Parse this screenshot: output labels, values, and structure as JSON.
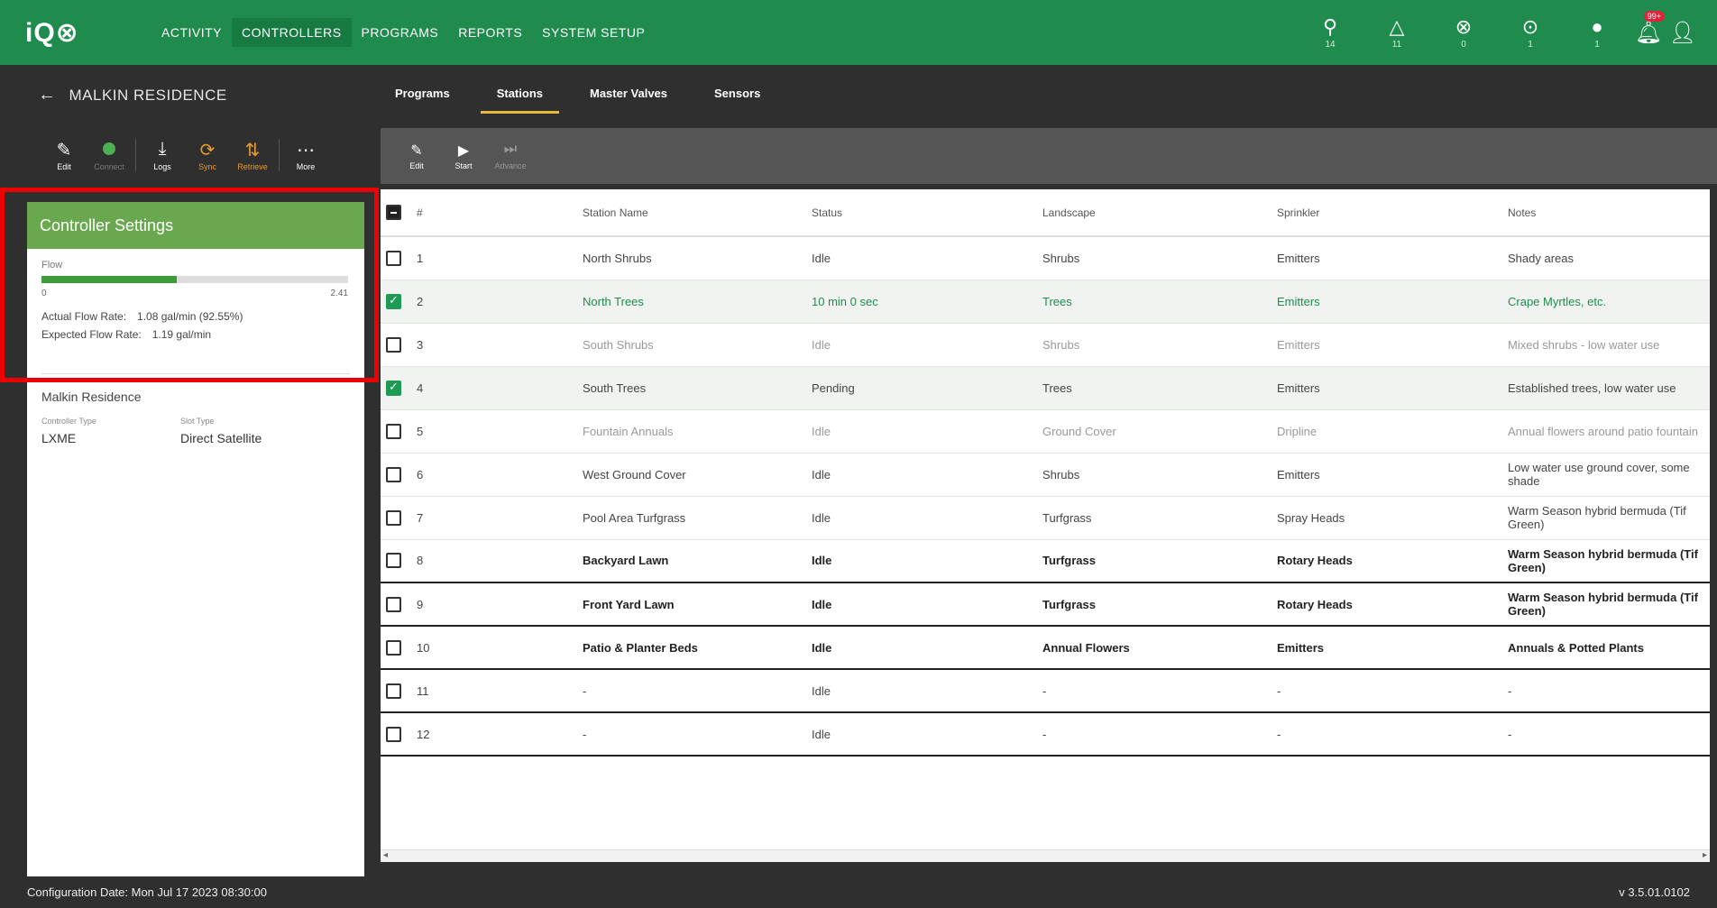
{
  "brand": {
    "logo": "iQ⊗"
  },
  "nav": {
    "items": [
      "ACTIVITY",
      "CONTROLLERS",
      "PROGRAMS",
      "REPORTS",
      "SYSTEM SETUP"
    ]
  },
  "status_icons": [
    {
      "icon": "flow-icon",
      "glyph": "⚲",
      "count": "14"
    },
    {
      "icon": "alert-triangle-icon",
      "glyph": "△",
      "count": "11"
    },
    {
      "icon": "stop-circle-icon",
      "glyph": "⊗",
      "count": "0"
    },
    {
      "icon": "play-circle-icon",
      "glyph": "⊙",
      "count": "1"
    },
    {
      "icon": "globe-icon",
      "glyph": "●",
      "count": "1"
    }
  ],
  "notifications": {
    "badge": "99+"
  },
  "left": {
    "back_label": "MALKIN RESIDENCE",
    "toolbar": [
      {
        "glyph": "✎",
        "label": "Edit",
        "style": ""
      },
      {
        "glyph": "",
        "label": "Connect",
        "style": "dim dotted"
      },
      {
        "glyph": "⤓",
        "label": "Logs",
        "style": ""
      },
      {
        "glyph": "⟳",
        "label": "Sync",
        "style": "orange"
      },
      {
        "glyph": "⇅",
        "label": "Retrieve",
        "style": "orange"
      },
      {
        "glyph": "⋯",
        "label": "More",
        "style": ""
      }
    ],
    "settings": {
      "title": "Controller Settings",
      "flow_label": "Flow",
      "flow_min": "0",
      "flow_max": "2.41",
      "flow_fraction": 0.44,
      "actual_label": "Actual Flow Rate:",
      "actual_value": "1.08 gal/min (92.55%)",
      "expected_label": "Expected Flow Rate:",
      "expected_value": "1.19 gal/min"
    },
    "residence": "Malkin Residence",
    "controller_type_label": "Controller Type",
    "controller_type": "LXME",
    "slot_type_label": "Slot Type",
    "slot_type": "Direct Satellite"
  },
  "tabs": [
    "Programs",
    "Stations",
    "Master Valves",
    "Sensors"
  ],
  "main_toolbar": [
    {
      "glyph": "✎",
      "label": "Edit",
      "dim": false
    },
    {
      "glyph": "▶",
      "label": "Start",
      "dim": false
    },
    {
      "glyph": "⏭",
      "label": "Advance",
      "dim": true
    }
  ],
  "table": {
    "headers": [
      "#",
      "Station Name",
      "Status",
      "Landscape",
      "Sprinkler",
      "Notes"
    ],
    "rows": [
      {
        "num": "1",
        "name": "North Shrubs",
        "status": "Idle",
        "landscape": "Shrubs",
        "sprinkler": "Emitters",
        "notes": "Shady areas",
        "checked": false,
        "sel": false,
        "cls": ""
      },
      {
        "num": "2",
        "name": "North Trees",
        "status": "10 min 0 sec",
        "landscape": "Trees",
        "sprinkler": "Emitters",
        "notes": "Crape Myrtles, etc.",
        "checked": true,
        "sel": true,
        "cls": "green"
      },
      {
        "num": "3",
        "name": "South Shrubs",
        "status": "Idle",
        "landscape": "Shrubs",
        "sprinkler": "Emitters",
        "notes": "Mixed shrubs - low water use",
        "checked": false,
        "sel": false,
        "cls": "muted"
      },
      {
        "num": "4",
        "name": "South Trees",
        "status": "Pending",
        "landscape": "Trees",
        "sprinkler": "Emitters",
        "notes": "Established trees, low water use",
        "checked": true,
        "sel": true,
        "cls": ""
      },
      {
        "num": "5",
        "name": "Fountain Annuals",
        "status": "Idle",
        "landscape": "Ground Cover",
        "sprinkler": "Dripline",
        "notes": "Annual flowers around patio fountain",
        "checked": false,
        "sel": false,
        "cls": "muted"
      },
      {
        "num": "6",
        "name": "West Ground Cover",
        "status": "Idle",
        "landscape": "Shrubs",
        "sprinkler": "Emitters",
        "notes": "Low water use ground cover, some shade",
        "checked": false,
        "sel": false,
        "cls": ""
      },
      {
        "num": "7",
        "name": "Pool Area Turfgrass",
        "status": "Idle",
        "landscape": "Turfgrass",
        "sprinkler": "Spray Heads",
        "notes": "Warm Season hybrid bermuda (Tif Green)",
        "checked": false,
        "sel": false,
        "cls": ""
      },
      {
        "num": "8",
        "name": "Backyard Lawn",
        "status": "Idle",
        "landscape": "Turfgrass",
        "sprinkler": "Rotary Heads",
        "notes": "Warm Season hybrid bermuda (Tif Green)",
        "checked": false,
        "sel": false,
        "cls": "bold heavy"
      },
      {
        "num": "9",
        "name": "Front Yard Lawn",
        "status": "Idle",
        "landscape": "Turfgrass",
        "sprinkler": "Rotary Heads",
        "notes": "Warm Season hybrid bermuda (Tif Green)",
        "checked": false,
        "sel": false,
        "cls": "bold heavy"
      },
      {
        "num": "10",
        "name": "Patio & Planter Beds",
        "status": "Idle",
        "landscape": "Annual Flowers",
        "sprinkler": "Emitters",
        "notes": "Annuals & Potted Plants",
        "checked": false,
        "sel": false,
        "cls": "bold heavy"
      },
      {
        "num": "11",
        "name": "-",
        "status": "Idle",
        "landscape": "-",
        "sprinkler": "-",
        "notes": "-",
        "checked": false,
        "sel": false,
        "cls": "heavy"
      },
      {
        "num": "12",
        "name": "-",
        "status": "Idle",
        "landscape": "-",
        "sprinkler": "-",
        "notes": "-",
        "checked": false,
        "sel": false,
        "cls": "heavy"
      }
    ]
  },
  "footer": {
    "left": "Configuration Date: Mon Jul 17 2023 08:30:00",
    "right": "v 3.5.01.0102"
  }
}
